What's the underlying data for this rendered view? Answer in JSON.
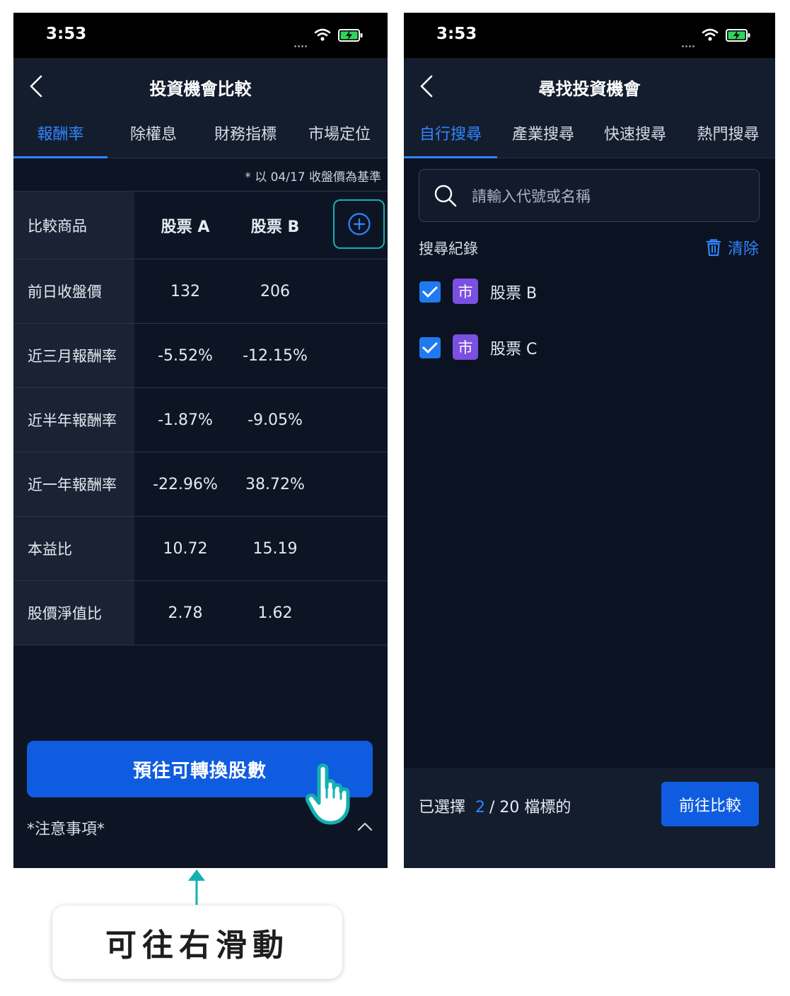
{
  "left_screen": {
    "status_time": "3:53",
    "nav_title": "投資機會比較",
    "tabs": [
      {
        "label": "報酬率",
        "active": true
      },
      {
        "label": "除權息",
        "active": false
      },
      {
        "label": "財務指標",
        "active": false
      },
      {
        "label": "市場定位",
        "active": false
      }
    ],
    "basis_note": "* 以 04/17 收盤價為基準",
    "table": {
      "header_label": "比較商品",
      "stocks": [
        "股票 A",
        "股票 B"
      ],
      "rows": [
        {
          "label": "前日收盤價",
          "a": "132",
          "b": "206"
        },
        {
          "label": "近三月報酬率",
          "a": "-5.52%",
          "b": "-12.15%"
        },
        {
          "label": "近半年報酬率",
          "a": "-1.87%",
          "b": "-9.05%"
        },
        {
          "label": "近一年報酬率",
          "a": "-22.96%",
          "b": "38.72%"
        },
        {
          "label": "本益比",
          "a": "10.72",
          "b": "15.19"
        },
        {
          "label": "股價淨值比",
          "a": "2.78",
          "b": "1.62"
        }
      ]
    },
    "primary_button": "預往可轉換股數",
    "notice": "*注意事項*"
  },
  "right_screen": {
    "status_time": "3:53",
    "nav_title": "尋找投資機會",
    "tabs": [
      {
        "label": "自行搜尋",
        "active": true
      },
      {
        "label": "產業搜尋",
        "active": false
      },
      {
        "label": "快速搜尋",
        "active": false
      },
      {
        "label": "熱門搜尋",
        "active": false
      }
    ],
    "search": {
      "placeholder": "請輸入代號或名稱",
      "value": ""
    },
    "history_title": "搜尋紀錄",
    "clear_label": "清除",
    "history_items": [
      {
        "badge": "市",
        "name": "股票 B",
        "checked": true
      },
      {
        "badge": "市",
        "name": "股票 C",
        "checked": true
      }
    ],
    "selected_prefix": "已選擇",
    "selected_count": "2",
    "selected_suffix": "/ 20 檔標的",
    "compare_button": "前往比較"
  },
  "hint": "可往右滑動",
  "colors": {
    "background": "#0d1525",
    "accent_blue": "#2f86ff",
    "button_blue": "#0f5ce0",
    "teal": "#13b0b2",
    "badge_purple": "#7b4fe0"
  }
}
